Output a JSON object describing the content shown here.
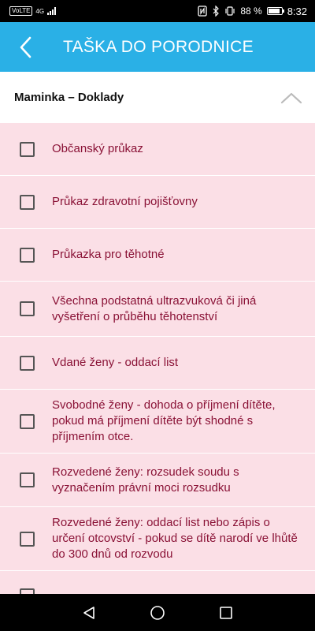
{
  "status_bar": {
    "network_tag": "VoLTE",
    "network_type": "4G",
    "battery": "88 %",
    "battery_level": 0.88,
    "time": "8:32",
    "icons": [
      "nfc-icon",
      "bluetooth-icon",
      "vibrate-icon"
    ]
  },
  "header": {
    "title": "TAŠKA DO PORODNICE",
    "back_icon": "chevron-left-icon"
  },
  "section": {
    "title": "Maminka – Doklady",
    "expanded": true,
    "toggle_icon": "chevron-up-icon"
  },
  "checklist": [
    {
      "label": "Občanský průkaz",
      "checked": false
    },
    {
      "label": "Průkaz zdravotní pojišťovny",
      "checked": false
    },
    {
      "label": "Průkazka pro těhotné",
      "checked": false
    },
    {
      "label": "Všechna podstatná ultrazvuková či jiná vyšetření o průběhu těhotenství",
      "checked": false
    },
    {
      "label": "Vdané ženy - oddací list",
      "checked": false
    },
    {
      "label": "Svobodné ženy - dohoda o příjmení dítěte, pokud má příjmení dítěte být shodné s příjmením otce.",
      "checked": false
    },
    {
      "label": "Rozvedené ženy: rozsudek soudu s vyznačením právní moci rozsudku",
      "checked": false
    },
    {
      "label": "Rozvedené ženy: oddací list nebo zápis o určení otcovství - pokud se dítě narodí ve lhůtě do 300 dnů od rozvodu",
      "checked": false
    },
    {
      "label": "",
      "checked": false
    }
  ],
  "nav_bar": {
    "buttons": [
      "back-triangle-icon",
      "home-circle-icon",
      "recents-square-icon"
    ]
  },
  "colors": {
    "app_bar": "#2ab0e6",
    "list_background": "#fbdfe6",
    "item_text": "#8a1236"
  }
}
